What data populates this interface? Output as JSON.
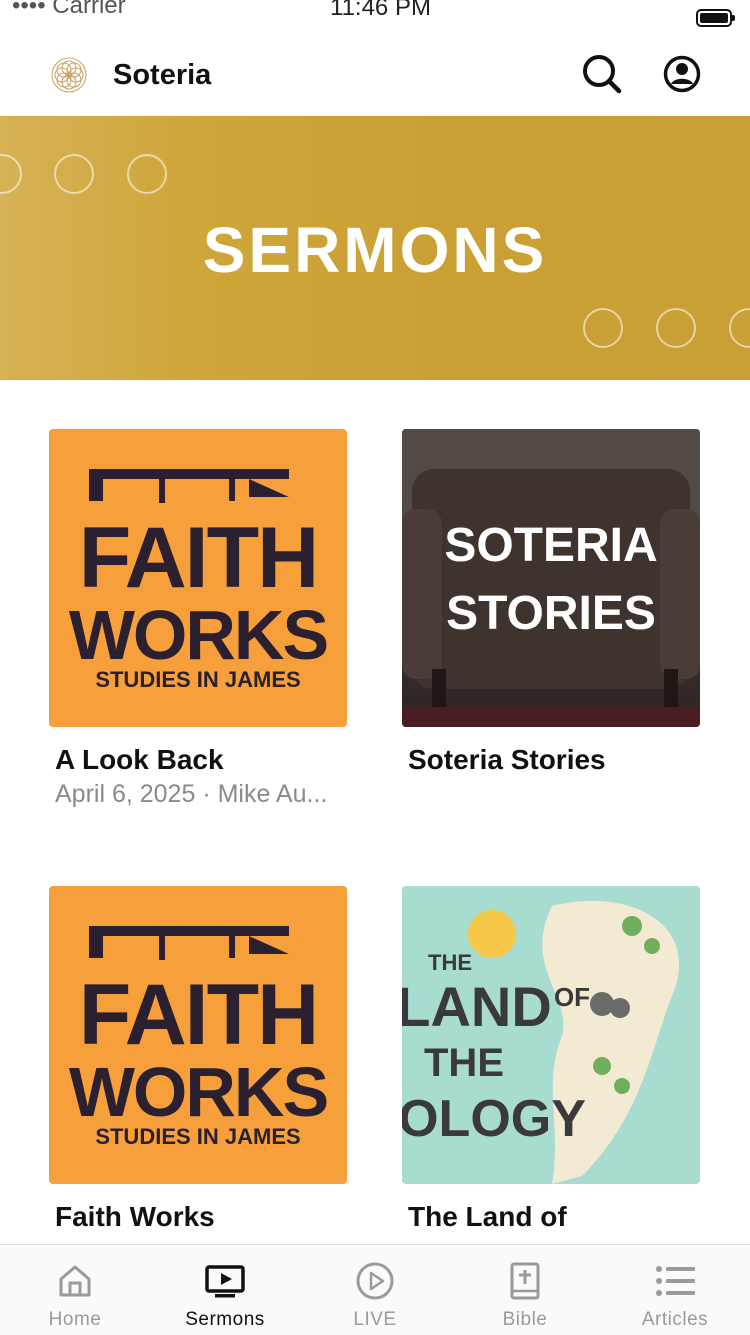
{
  "status_bar": {
    "carrier": "•••• Carrier",
    "time": "11:46 PM"
  },
  "header": {
    "app_title": "Soteria",
    "logo_icon": "soteria-logo-icon",
    "search_icon": "search-icon",
    "account_icon": "account-icon"
  },
  "banner": {
    "title": "SERMONS"
  },
  "cards": [
    {
      "art": "faith-works-art",
      "art_lines": [
        "FAITH",
        "WORKS",
        "STUDIES IN JAMES"
      ],
      "title": "A Look Back",
      "subtitle": "April 6, 2025 · Mike Au..."
    },
    {
      "art": "soteria-stories-art",
      "art_lines": [
        "SOTERIA",
        "STORIES"
      ],
      "title": "Soteria Stories",
      "subtitle": ""
    },
    {
      "art": "faith-works-art",
      "art_lines": [
        "FAITH",
        "WORKS",
        "STUDIES IN JAMES"
      ],
      "title": "Faith Works",
      "subtitle": ""
    },
    {
      "art": "land-of-theology-art",
      "art_lines": [
        "THE",
        "LAND",
        "OF",
        "THE",
        "OLOGY"
      ],
      "title": "The Land of",
      "subtitle": ""
    }
  ],
  "tabs": [
    {
      "label": "Home",
      "icon": "home-icon",
      "active": false
    },
    {
      "label": "Sermons",
      "icon": "tv-play-icon",
      "active": true
    },
    {
      "label": "LIVE",
      "icon": "play-circle-icon",
      "active": false
    },
    {
      "label": "Bible",
      "icon": "bible-icon",
      "active": false
    },
    {
      "label": "Articles",
      "icon": "list-icon",
      "active": false
    }
  ],
  "colors": {
    "banner_gold": "#cba236",
    "card_orange": "#f7a03b",
    "active_tab": "#111111",
    "inactive_tab": "#9a9a9a"
  }
}
